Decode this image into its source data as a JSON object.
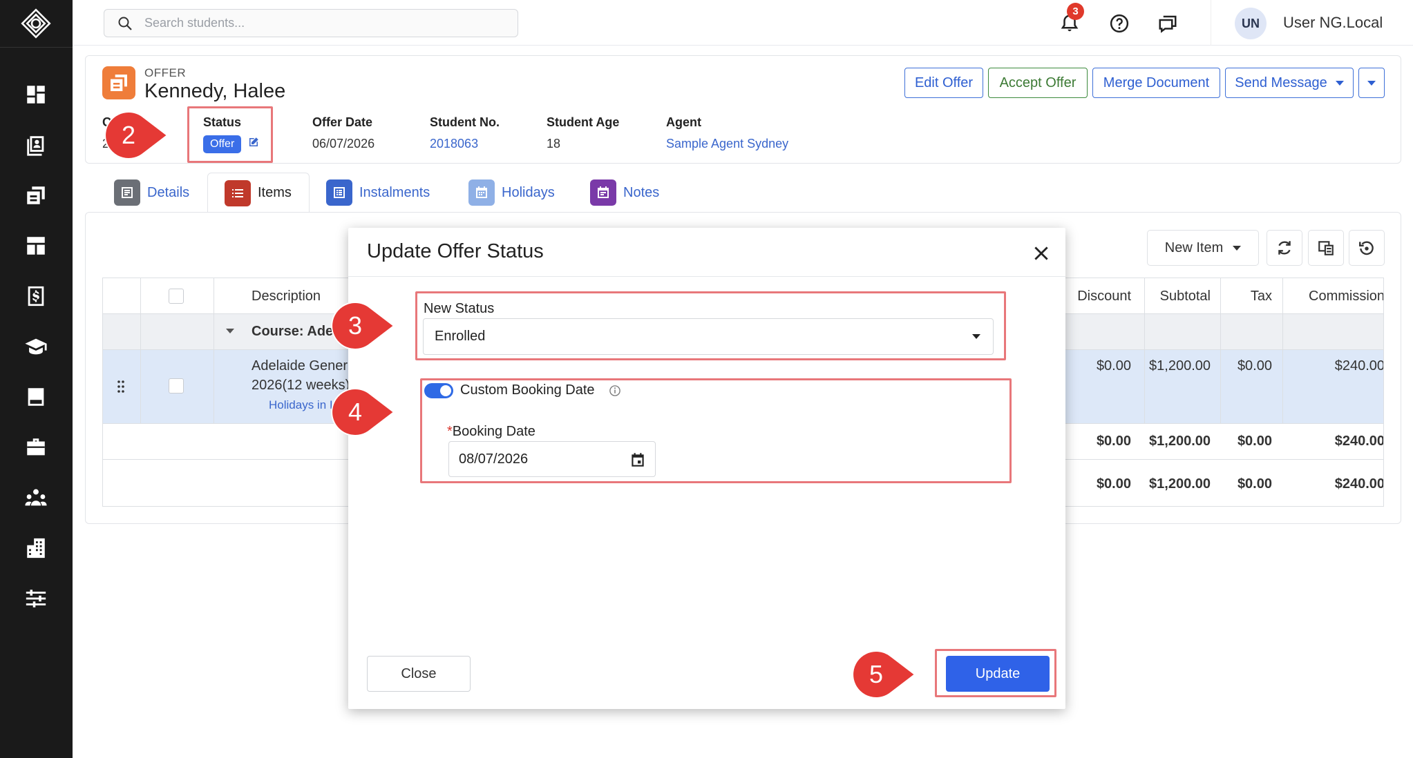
{
  "topbar": {
    "search_placeholder": "Search students...",
    "notification_count": "3",
    "user_initials": "UN",
    "user_name": "User NG.Local"
  },
  "header": {
    "label": "OFFER",
    "name": "Kennedy, Halee",
    "buttons": {
      "edit": "Edit Offer",
      "accept": "Accept Offer",
      "merge": "Merge Document",
      "send": "Send Message"
    },
    "fields": {
      "o_label_partial": "O",
      "o_value_partial": "2",
      "status_label": "Status",
      "status_value": "Offer",
      "offer_date_label": "Offer Date",
      "offer_date_value": "06/07/2026",
      "student_no_label": "Student No.",
      "student_no_value": "2018063",
      "student_age_label": "Student Age",
      "student_age_value": "18",
      "agent_label": "Agent",
      "agent_value": "Sample Agent Sydney"
    }
  },
  "tabs": [
    {
      "label": "Details",
      "color": "#6b6f76"
    },
    {
      "label": "Items",
      "color": "#c0392b"
    },
    {
      "label": "Instalments",
      "color": "#3a66cc"
    },
    {
      "label": "Holidays",
      "color": "#8fb0e6"
    },
    {
      "label": "Notes",
      "color": "#7a3aa8"
    }
  ],
  "toolbar": {
    "new_item": "New Item"
  },
  "grid": {
    "columns": {
      "description": "Description",
      "discount": "Discount",
      "subtotal": "Subtotal",
      "tax": "Tax",
      "commission": "Commission"
    },
    "group_label": "Course: Adel",
    "item": {
      "line1": "Adelaide Gener",
      "line2": "2026(12 weeks)",
      "holidays": "Holidays in I",
      "discount": "$0.00",
      "subtotal": "$1,200.00",
      "tax": "$0.00",
      "commission": "$240.00"
    },
    "subtotal_row": {
      "discount": "$0.00",
      "subtotal": "$1,200.00",
      "tax": "$0.00",
      "commission": "$240.00"
    },
    "total_row": {
      "discount": "$0.00",
      "subtotal": "$1,200.00",
      "tax": "$0.00",
      "commission": "$240.00"
    }
  },
  "modal": {
    "title": "Update Offer Status",
    "new_status_label": "New Status",
    "new_status_value": "Enrolled",
    "custom_booking_label": "Custom Booking Date",
    "booking_date_label": "Booking Date",
    "booking_date_value": "08/07/2026",
    "close_label": "Close",
    "update_label": "Update"
  },
  "callouts": {
    "c2": "2",
    "c3": "3",
    "c4": "4",
    "c5": "5"
  },
  "colors": {
    "accent": "#2f62e8",
    "highlight": "#e8777a",
    "callout": "#e53935",
    "sidebar": "#1a1a1a"
  }
}
